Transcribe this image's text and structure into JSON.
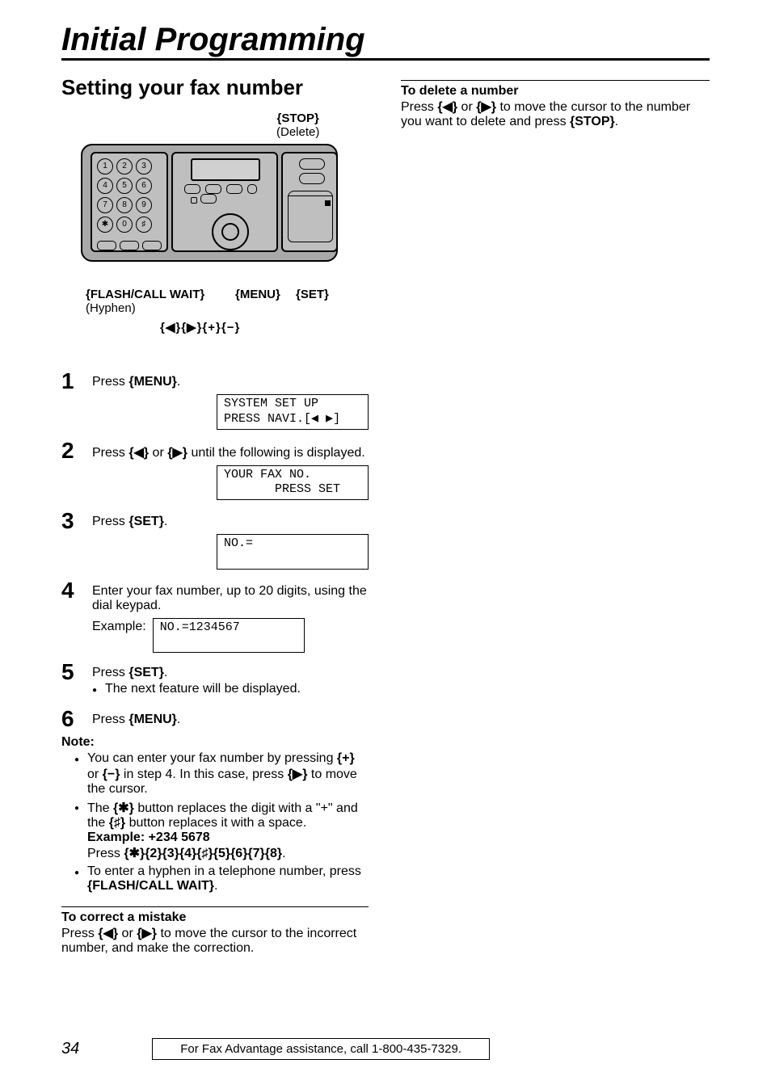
{
  "chapter_title": "Initial Programming",
  "section_title": "Setting your fax number",
  "callouts": {
    "stop_key": "{STOP}",
    "stop_sub": "(Delete)",
    "flash_key": "{FLASH/CALL WAIT}",
    "flash_sub": "(Hyphen)",
    "menu_key": "{MENU}",
    "set_key": "{SET}",
    "nav_keys": "{◀}{▶}{+}{−}"
  },
  "keys": {
    "menu": "{MENU}",
    "set": "{SET}",
    "stop": "{STOP}",
    "flash": "{FLASH/CALL WAIT}",
    "left": "{◀}",
    "right": "{▶}",
    "plus": "{+}",
    "minus": "{−}",
    "star": "{✱}",
    "hash": "{♯}"
  },
  "steps": {
    "s1": {
      "num": "1",
      "text_a": "Press ",
      "text_b": "."
    },
    "lcd1_l1": "SYSTEM SET UP",
    "lcd1_l2": "PRESS NAVI.[◀ ▶]",
    "s2": {
      "num": "2",
      "text_a": "Press ",
      "text_mid": " or ",
      "text_b": " until the following is displayed."
    },
    "lcd2_l1": "YOUR FAX NO.",
    "lcd2_l2": "       PRESS SET",
    "s3": {
      "num": "3",
      "text_a": "Press ",
      "text_b": "."
    },
    "lcd3_l1": "NO.=",
    "lcd3_l2": " ",
    "s4": {
      "num": "4",
      "text": "Enter your fax number, up to 20 digits, using the dial keypad."
    },
    "example_label": "Example:",
    "lcd4_l1": "NO.=1234567",
    "lcd4_l2": " ",
    "s5": {
      "num": "5",
      "text_a": "Press ",
      "text_b": ".",
      "bullet": "The next feature will be displayed."
    },
    "s6": {
      "num": "6",
      "text_a": "Press ",
      "text_b": "."
    }
  },
  "note_heading": "Note:",
  "notes": {
    "n1_a": "You can enter your fax number by pressing ",
    "n1_b": " or ",
    "n1_c": " in step 4. In this case, press ",
    "n1_d": " to move the cursor.",
    "n2_a": "The ",
    "n2_b": " button replaces the digit with a \"+\" and the ",
    "n2_c": " button replaces it with a space.",
    "n2_example_label": "Example: +234 5678",
    "n2_press": "Press ",
    "n2_seq": "{✱}{2}{3}{4}{♯}{5}{6}{7}{8}",
    "n2_end": ".",
    "n3_a": "To enter a hyphen in a telephone number, press ",
    "n3_b": "."
  },
  "correct_heading": "To correct a mistake",
  "correct_a": "Press ",
  "correct_b": " or ",
  "correct_c": " to move the cursor to the incorrect number, and make the correction.",
  "delete_heading": "To delete a number",
  "delete_a": "Press ",
  "delete_b": " or ",
  "delete_c": " to move the cursor to the number you want to delete and press ",
  "delete_d": ".",
  "footer": {
    "page": "34",
    "text": "For Fax Advantage assistance, call 1-800-435-7329."
  },
  "keypad_glyphs": [
    "1",
    "2",
    "3",
    "4",
    "5",
    "6",
    "7",
    "8",
    "9",
    "✱",
    "0",
    "♯"
  ]
}
